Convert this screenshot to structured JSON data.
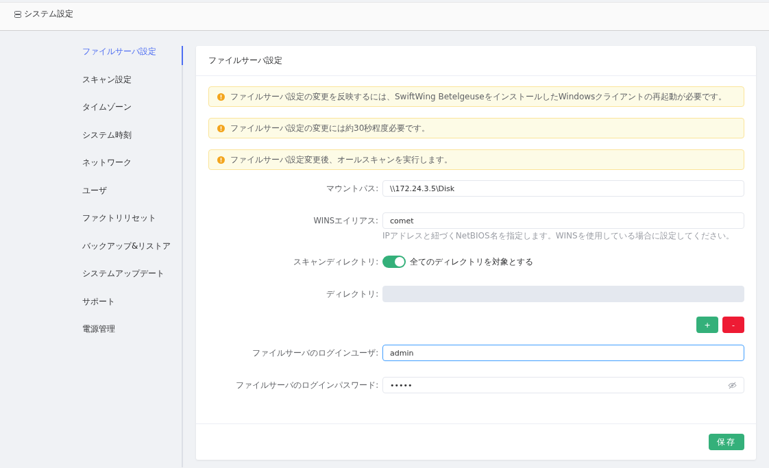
{
  "header": {
    "title": "システム設定"
  },
  "sidebar": {
    "items": [
      {
        "label": "ファイルサーバ設定",
        "selected": true
      },
      {
        "label": "スキャン設定",
        "selected": false
      },
      {
        "label": "タイムゾーン",
        "selected": false
      },
      {
        "label": "システム時刻",
        "selected": false
      },
      {
        "label": "ネットワーク",
        "selected": false
      },
      {
        "label": "ユーザ",
        "selected": false
      },
      {
        "label": "ファクトリリセット",
        "selected": false
      },
      {
        "label": "バックアップ&リストア",
        "selected": false
      },
      {
        "label": "システムアップデート",
        "selected": false
      },
      {
        "label": "サポート",
        "selected": false
      },
      {
        "label": "電源管理",
        "selected": false
      }
    ]
  },
  "panel": {
    "title": "ファイルサーバ設定",
    "alerts": [
      "ファイルサーバ設定の変更を反映するには、SwiftWing BetelgeuseをインストールしたWindowsクライアントの再起動が必要です。",
      "ファイルサーバ設定の変更には約30秒程度必要です。",
      "ファイルサーバ設定変更後、オールスキャンを実行します。"
    ],
    "fields": [
      {
        "kind": "input",
        "label": "マウントパス:",
        "value": "\\\\172.24.3.5\\Disk",
        "focused": false
      },
      {
        "kind": "input",
        "label": "WINSエイリアス:",
        "value": "comet",
        "focused": false,
        "hint": "IPアドレスと紐づくNetBIOS名を指定します。WINSを使用している場合に設定してください。"
      },
      {
        "kind": "switch",
        "label": "スキャンディレクトリ:",
        "on": true,
        "text": "全てのディレクトリを対象とする"
      },
      {
        "kind": "disabled",
        "label": "ディレクトリ:"
      },
      {
        "kind": "buttons",
        "add": "+",
        "remove": "-"
      },
      {
        "kind": "input",
        "label": "ファイルサーバのログインユーザ:",
        "value": "admin",
        "focused": true
      },
      {
        "kind": "password",
        "label": "ファイルサーバのログインパスワード:",
        "value": "•••••",
        "focused": false
      }
    ],
    "save": "保存"
  }
}
